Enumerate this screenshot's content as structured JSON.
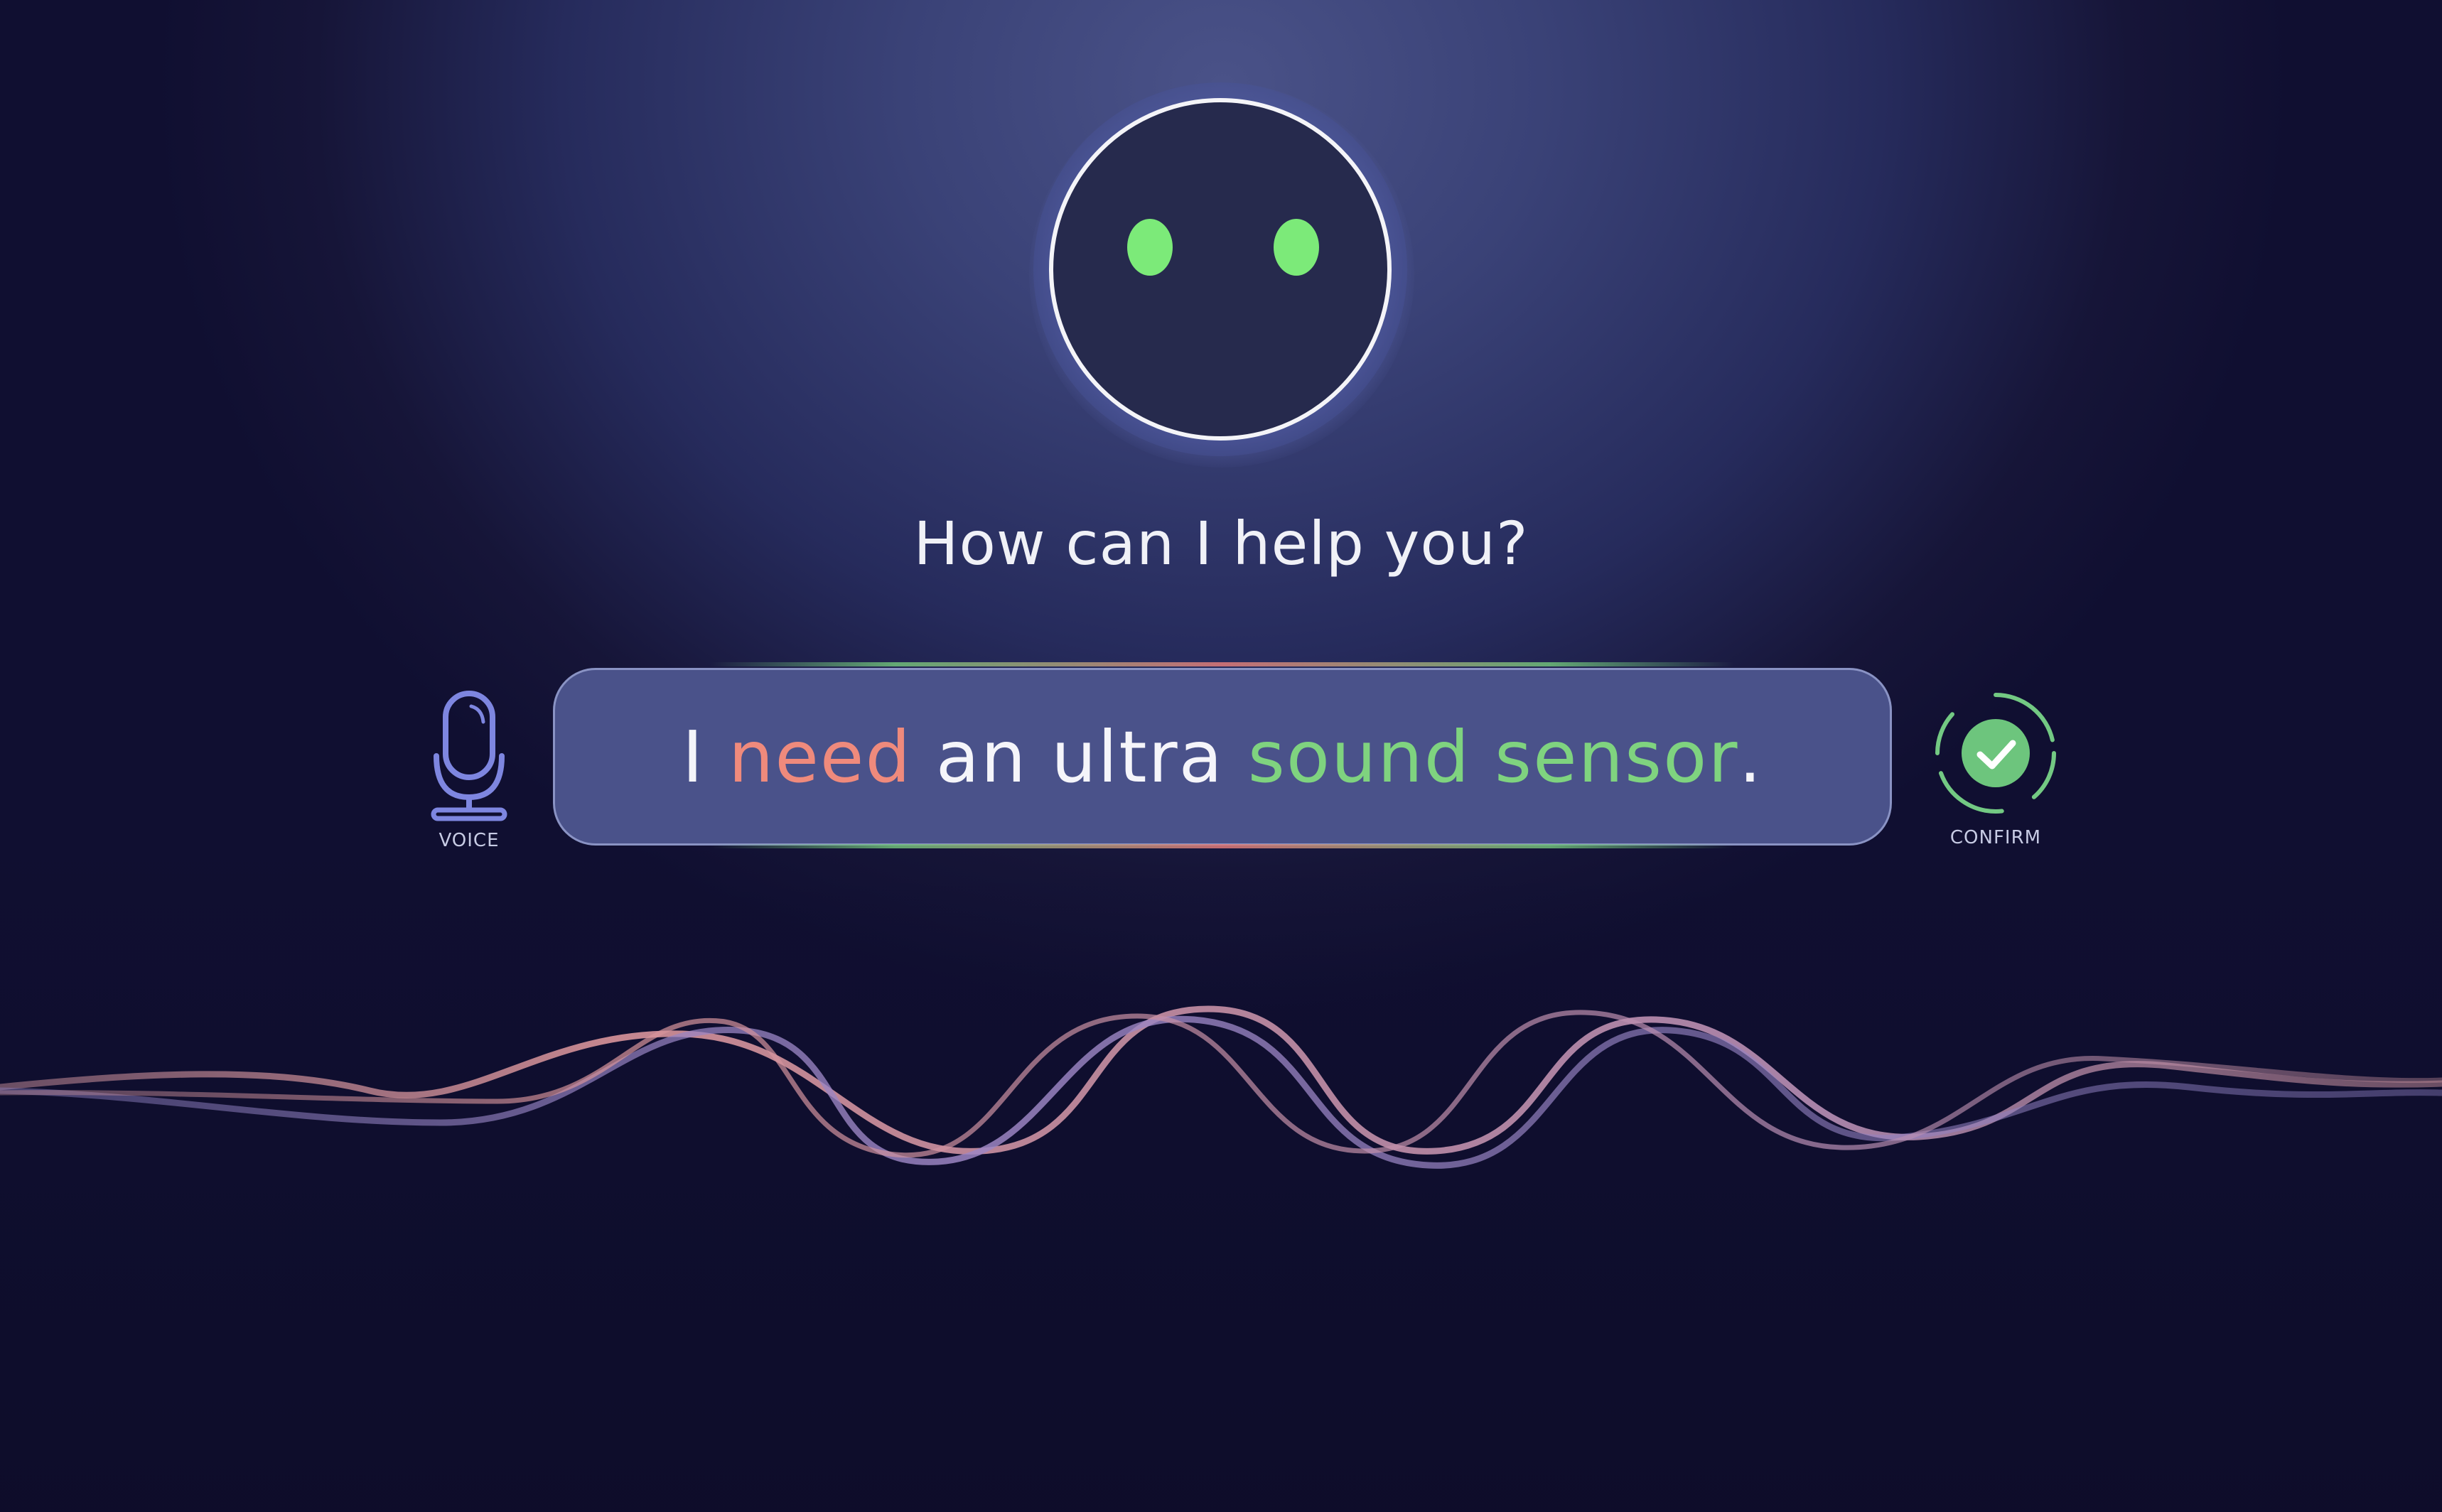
{
  "prompt": "How can I help you?",
  "input": {
    "segments": [
      {
        "text": "I ",
        "color": "white"
      },
      {
        "text": "need",
        "color": "red"
      },
      {
        "text": " an ultra ",
        "color": "white"
      },
      {
        "text": "sound sensor",
        "color": "green"
      },
      {
        "text": ".",
        "color": "white"
      }
    ]
  },
  "voice": {
    "label": "VOICE",
    "icon": "microphone-icon"
  },
  "confirm": {
    "label": "CONFIRM",
    "icon": "check-circle-icon"
  },
  "colors": {
    "eyes": "#7cea79",
    "highlight_red": "#ef8a7c",
    "highlight_green": "#7fd37f",
    "accent_blue": "#7e86e0"
  }
}
